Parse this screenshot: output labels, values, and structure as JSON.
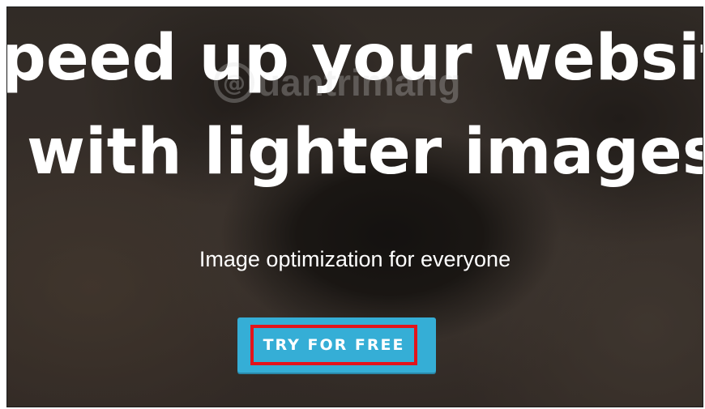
{
  "hero": {
    "headline_line1": "peed up your website",
    "headline_line2": "with lighter images",
    "subtitle": "Image optimization for everyone",
    "cta_label": "TRY FOR FREE"
  },
  "watermark": {
    "icon": "@",
    "text": "uantrimang"
  },
  "colors": {
    "cta_background": "#35aed6",
    "highlight_border": "#e3141b",
    "text": "#ffffff"
  }
}
